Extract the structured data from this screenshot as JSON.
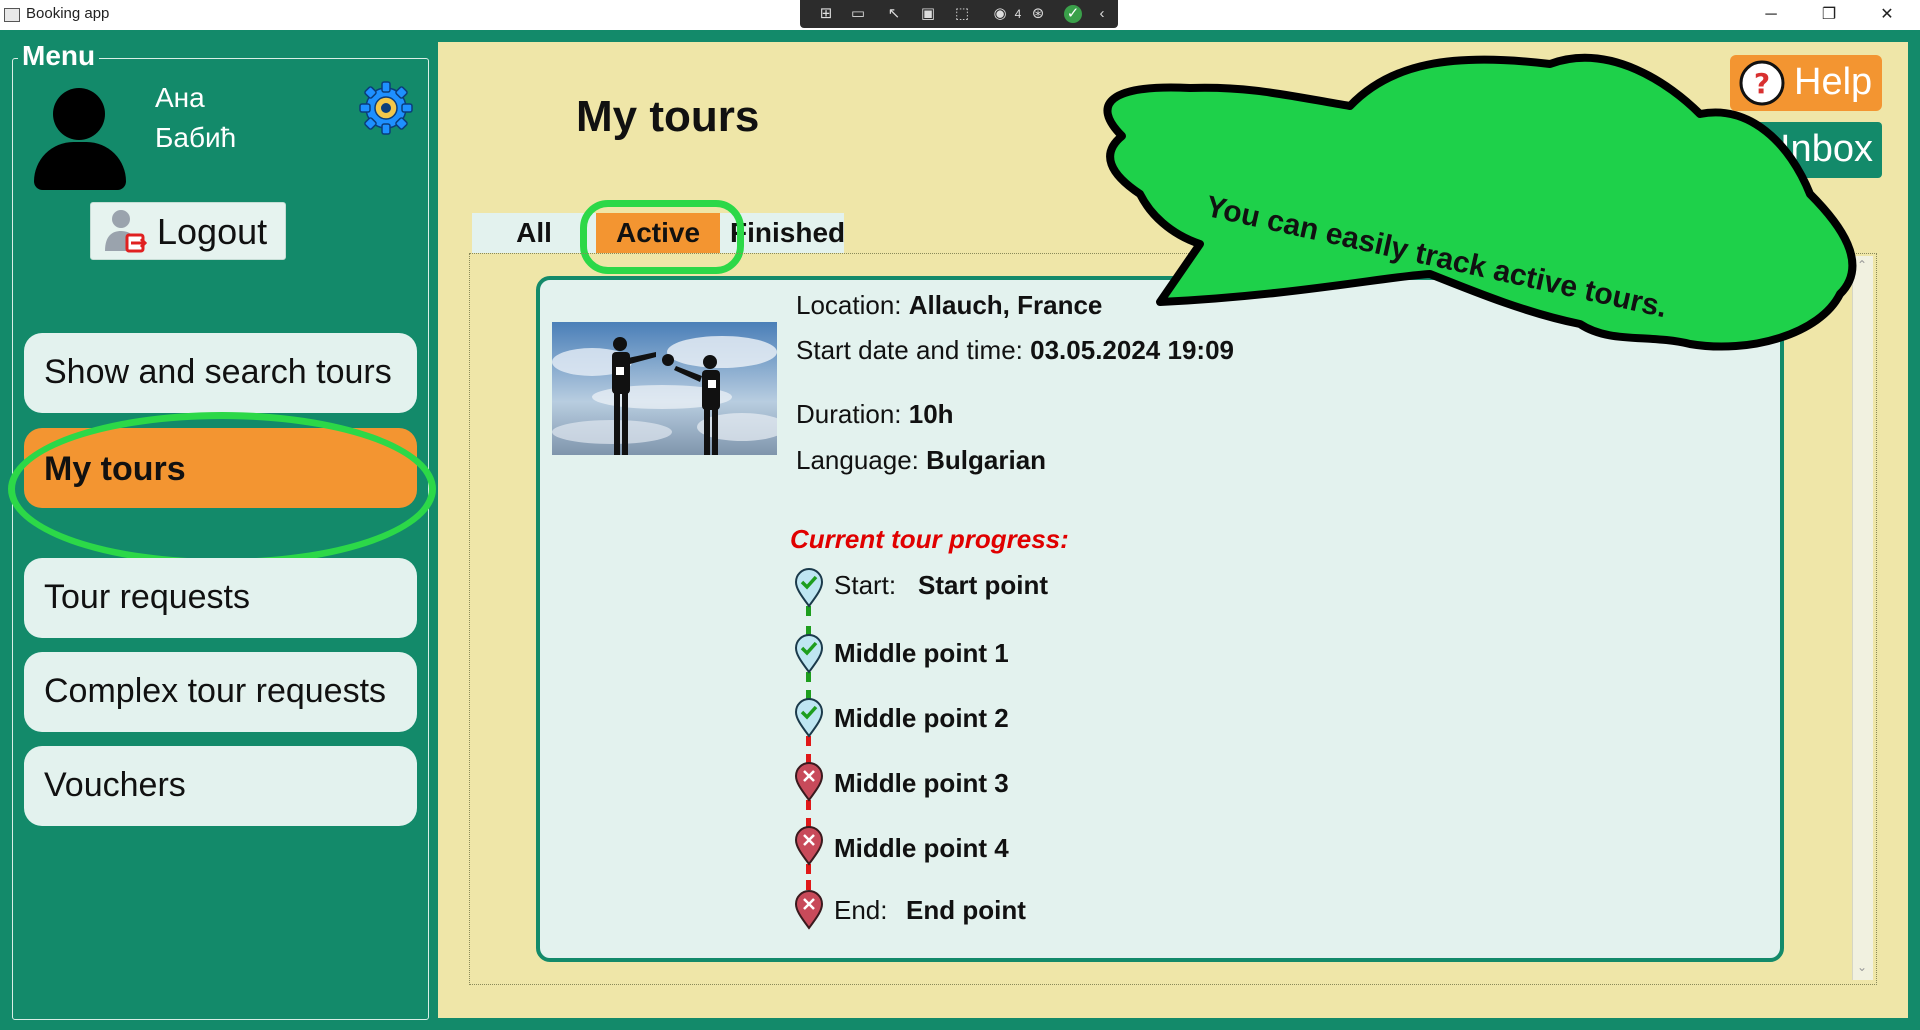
{
  "window": {
    "title": "Booking app",
    "controls": {
      "minimize": "─",
      "restore": "❐",
      "close": "✕"
    },
    "devtools_badge": "4"
  },
  "sidebar": {
    "legend": "Menu",
    "user": {
      "first_name": "Ана",
      "last_name": "Бабић"
    },
    "logout_label": "Logout",
    "items": [
      {
        "label": "Show and search tours",
        "active": false
      },
      {
        "label": "My tours",
        "active": true
      },
      {
        "label": "Tour requests",
        "active": false
      },
      {
        "label": "Complex tour requests",
        "active": false
      },
      {
        "label": "Vouchers",
        "active": false
      }
    ]
  },
  "header": {
    "title": "My tours",
    "help_label": "Help",
    "inbox_label": "Inbox"
  },
  "tabs": [
    {
      "label": "All",
      "selected": false
    },
    {
      "label": "Active",
      "selected": true
    },
    {
      "label": "Finished",
      "selected": false
    }
  ],
  "tooltip": {
    "text": "You can easily track active tours."
  },
  "tour": {
    "location_label": "Location:",
    "location": "Allauch, France",
    "start_label": "Start date and time:",
    "start": "03.05.2024 19:09",
    "duration_label": "Duration:",
    "duration": "10h",
    "language_label": "Language:",
    "language": "Bulgarian",
    "progress_title": "Current tour progress:",
    "checkpoints": [
      {
        "prefix": "Start:",
        "name": "Start point",
        "status": "done"
      },
      {
        "prefix": "",
        "name": "Middle point 1",
        "status": "done"
      },
      {
        "prefix": "",
        "name": "Middle point 2",
        "status": "done"
      },
      {
        "prefix": "",
        "name": "Middle point 3",
        "status": "pending"
      },
      {
        "prefix": "",
        "name": "Middle point 4",
        "status": "pending"
      },
      {
        "prefix": "End:",
        "name": "End point",
        "status": "pending"
      }
    ]
  },
  "colors": {
    "brand_green": "#138a6a",
    "accent_orange": "#f39531",
    "highlight_green": "#2cd848",
    "panel_yellow": "#efe6a8",
    "card_bg": "#e3f2ee",
    "progress_red": "#e00000"
  }
}
